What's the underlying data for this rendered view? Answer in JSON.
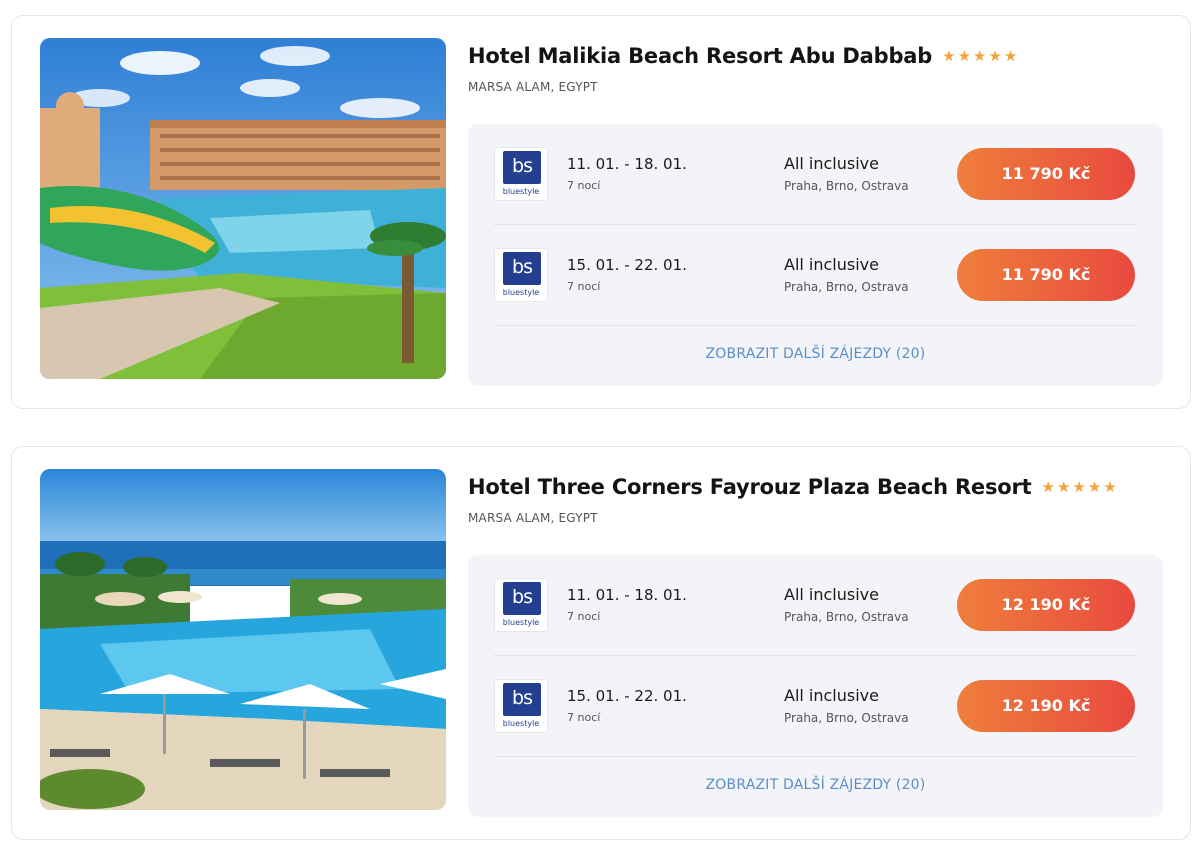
{
  "hotels": [
    {
      "name": "Hotel Malikia Beach Resort Abu Dabbab",
      "stars": 5,
      "location": "MARSA ALAM, EGYPT",
      "photo_description": "resort-with-waterslides",
      "offers": [
        {
          "operator_logo": "bs",
          "operator_name": "bluestyle",
          "dates": "11. 01. - 18. 01.",
          "nights": "7 nocí",
          "board": "All inclusive",
          "airports": "Praha, Brno, Ostrava",
          "price": "11 790 Kč"
        },
        {
          "operator_logo": "bs",
          "operator_name": "bluestyle",
          "dates": "15. 01. - 22. 01.",
          "nights": "7 nocí",
          "board": "All inclusive",
          "airports": "Praha, Brno, Ostrava",
          "price": "11 790 Kč"
        }
      ],
      "more_link": "ZOBRAZIT DALŠÍ ZÁJEZDY (20)"
    },
    {
      "name": "Hotel Three Corners Fayrouz Plaza Beach Resort",
      "stars": 5,
      "location": "MARSA ALAM, EGYPT",
      "photo_description": "pool-with-sea-view",
      "offers": [
        {
          "operator_logo": "bs",
          "operator_name": "bluestyle",
          "dates": "11. 01. - 18. 01.",
          "nights": "7 nocí",
          "board": "All inclusive",
          "airports": "Praha, Brno, Ostrava",
          "price": "12 190 Kč"
        },
        {
          "operator_logo": "bs",
          "operator_name": "bluestyle",
          "dates": "15. 01. - 22. 01.",
          "nights": "7 nocí",
          "board": "All inclusive",
          "airports": "Praha, Brno, Ostrava",
          "price": "12 190 Kč"
        }
      ],
      "more_link": "ZOBRAZIT DALŠÍ ZÁJEZDY (20)"
    }
  ],
  "colors": {
    "star": "#f3a33a",
    "button_gradient_start": "#ef7e3c",
    "button_gradient_end": "#e84a3e",
    "link": "#5b8ec9",
    "operator_brand": "#243f8f",
    "offers_background": "#f2f4f7"
  },
  "icons": {
    "star": "star-icon"
  }
}
